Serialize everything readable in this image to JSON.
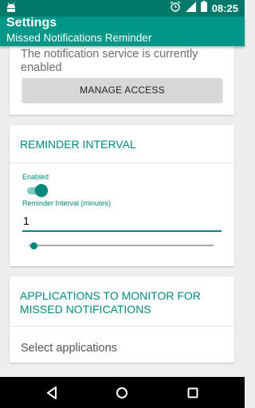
{
  "status_bar": {
    "time": "08:25",
    "icons": [
      "android-notification-icon",
      "alarm-icon",
      "signal-icon",
      "battery-icon"
    ]
  },
  "app_bar": {
    "title": "Settings",
    "subtitle": "Missed Notifications Reminder"
  },
  "notification_service": {
    "status_text": "The notification service is currently enabled",
    "manage_button_label": "MANAGE ACCESS"
  },
  "reminder_interval": {
    "section_title": "REMINDER INTERVAL",
    "enabled_label": "Enabled",
    "enabled": true,
    "interval_label": "Reminder Interval (minutes)",
    "interval_value": "1",
    "slider_level_fraction": 0.02
  },
  "applications": {
    "section_title": "APPLICATIONS TO MONITOR FOR MISSED NOTIFICATIONS",
    "select_label": "Select applications"
  },
  "nav_bar": {
    "icons": [
      "back-icon",
      "home-icon",
      "recents-icon"
    ]
  },
  "colors": {
    "primary": "#009688",
    "primary_dark": "#00796b",
    "accent": "#00897b"
  }
}
